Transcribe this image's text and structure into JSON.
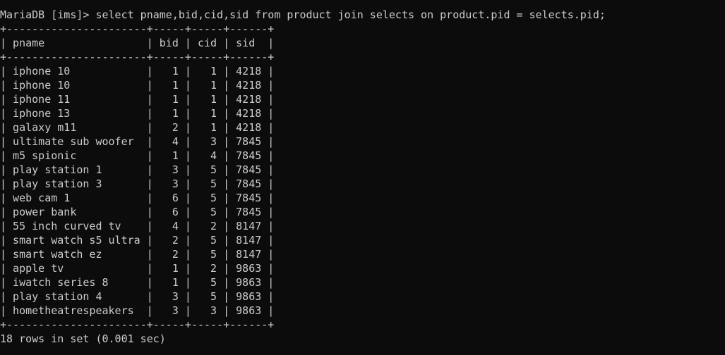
{
  "console": {
    "prompt": "MariaDB [ims]> ",
    "command": "select pname,bid,cid,sid from product join selects on product.pid = selects.pid;",
    "border": "+----------------------+-----+-----+------+",
    "columns": [
      "pname",
      "bid",
      "cid",
      "sid"
    ],
    "header_line": "| pname                | bid | cid | sid  |",
    "rows": [
      "| iphone 10            |   1 |   1 | 4218 |",
      "| iphone 10            |   1 |   1 | 4218 |",
      "| iphone 11            |   1 |   1 | 4218 |",
      "| iphone 13            |   1 |   1 | 4218 |",
      "| galaxy m11           |   2 |   1 | 4218 |",
      "| ultimate sub woofer  |   4 |   3 | 7845 |",
      "| m5 spionic           |   1 |   4 | 7845 |",
      "| play station 1       |   3 |   5 | 7845 |",
      "| play station 3       |   3 |   5 | 7845 |",
      "| web cam 1            |   6 |   5 | 7845 |",
      "| power bank           |   6 |   5 | 7845 |",
      "| 55 inch curved tv    |   4 |   2 | 8147 |",
      "| smart watch s5 ultra |   2 |   5 | 8147 |",
      "| smart watch ez       |   2 |   5 | 8147 |",
      "| apple tv             |   1 |   2 | 9863 |",
      "| iwatch series 8      |   1 |   5 | 9863 |",
      "| play station 4       |   3 |   5 | 9863 |",
      "| hometheatrespeakers  |   3 |   3 | 9863 |"
    ],
    "summary": "18 rows in set (0.001 sec)",
    "colors": {
      "background": "#0c0c0c",
      "text": "#cccccc"
    }
  }
}
